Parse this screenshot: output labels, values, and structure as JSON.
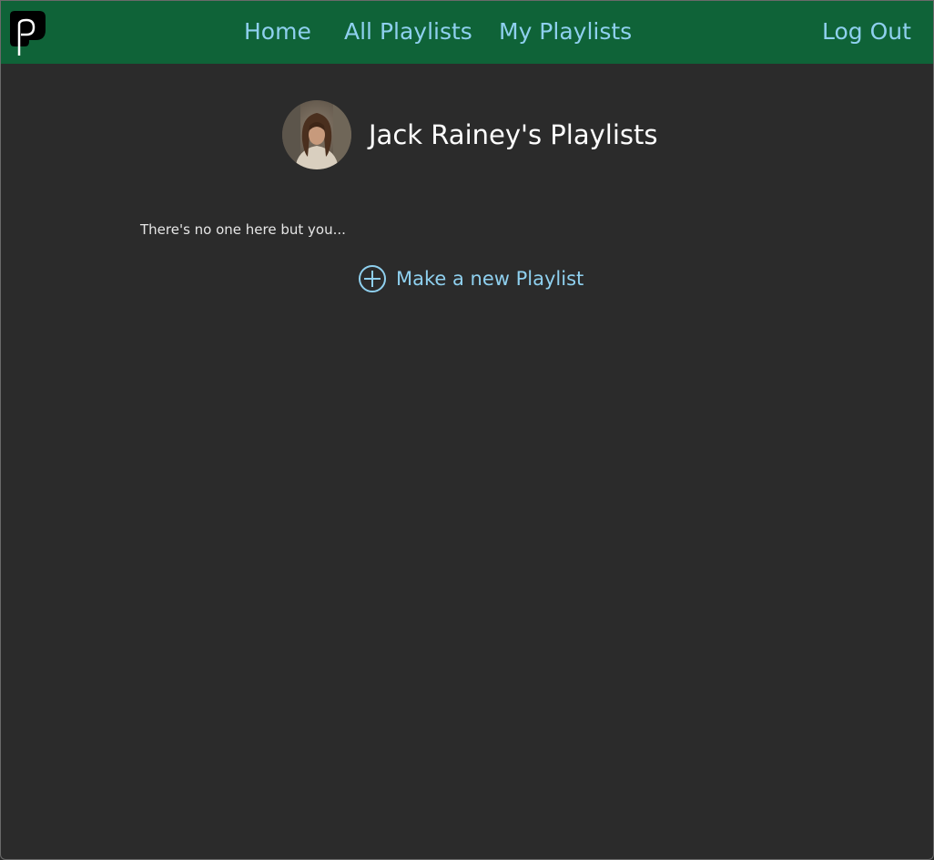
{
  "navbar": {
    "logo_icon": "app-logo-icon",
    "links": {
      "home": "Home",
      "all_playlists": "All Playlists",
      "my_playlists": "My Playlists",
      "log_out": "Log Out"
    },
    "bg_color": "#0f6338",
    "link_color": "#8fd0ef"
  },
  "profile": {
    "avatar_icon": "user-avatar",
    "title": "Jack Rainey's Playlists"
  },
  "main": {
    "empty_message": "There's no one here but you...",
    "new_playlist": {
      "icon": "plus-circle-icon",
      "label": "Make a new Playlist"
    }
  }
}
